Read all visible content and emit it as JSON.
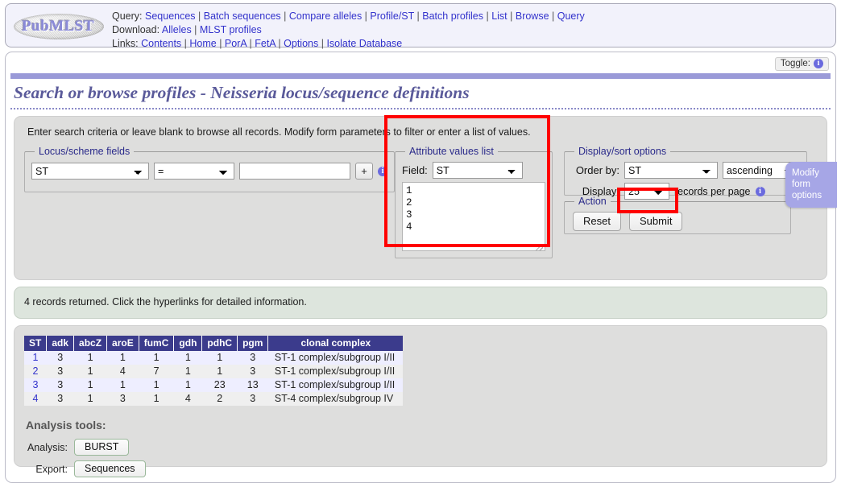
{
  "header": {
    "logo_text": "PubMLST",
    "nav": [
      {
        "label": "Query:",
        "links": [
          "Sequences",
          "Batch sequences",
          "Compare alleles",
          "Profile/ST",
          "Batch profiles",
          "List",
          "Browse",
          "Query"
        ]
      },
      {
        "label": "Download:",
        "links": [
          "Alleles",
          "MLST profiles"
        ]
      },
      {
        "label": "Links:",
        "links": [
          "Contents",
          "Home",
          "PorA",
          "FetA",
          "Options",
          "Isolate Database"
        ]
      }
    ]
  },
  "toggle": {
    "label": "Toggle:",
    "icon": "info-icon"
  },
  "page": {
    "title": "Search or browse profiles - Neisseria locus/sequence definitions",
    "intro": "Enter search criteria or leave blank to browse all records. Modify form parameters to filter or enter a list of values."
  },
  "modify_tab": {
    "line1": "Modify",
    "line2": "form",
    "line3": "options"
  },
  "form": {
    "locus_fieldset": {
      "legend": "Locus/scheme fields",
      "field_value": "ST",
      "operator_value": "=",
      "text_value": "",
      "text_placeholder": "",
      "add_button": "+",
      "info_icon": "info-icon"
    },
    "attribute_fieldset": {
      "legend": "Attribute values list",
      "field_label": "Field:",
      "field_value": "ST",
      "textarea_value": "1\n2\n3\n4"
    },
    "display_fieldset": {
      "legend": "Display/sort options",
      "order_label": "Order by:",
      "order_value": "ST",
      "direction_value": "ascending",
      "display_label": "Display:",
      "display_value": "25",
      "display_tail": "records per page",
      "info_icon": "info-icon"
    },
    "action_fieldset": {
      "legend": "Action",
      "reset_label": "Reset",
      "submit_label": "Submit"
    }
  },
  "result_message": "4 records returned. Click the hyperlinks for detailed information.",
  "results_table": {
    "columns": [
      "ST",
      "adk",
      "abcZ",
      "aroE",
      "fumC",
      "gdh",
      "pdhC",
      "pgm",
      "clonal complex"
    ],
    "rows": [
      {
        "st": "1",
        "adk": "3",
        "abcZ": "1",
        "aroE": "1",
        "fumC": "1",
        "gdh": "1",
        "pdhC": "1",
        "pgm": "3",
        "clonal_complex": "ST-1 complex/subgroup I/II"
      },
      {
        "st": "2",
        "adk": "3",
        "abcZ": "1",
        "aroE": "4",
        "fumC": "7",
        "gdh": "1",
        "pdhC": "1",
        "pgm": "3",
        "clonal_complex": "ST-1 complex/subgroup I/II"
      },
      {
        "st": "3",
        "adk": "3",
        "abcZ": "1",
        "aroE": "1",
        "fumC": "1",
        "gdh": "1",
        "pdhC": "23",
        "pgm": "13",
        "clonal_complex": "ST-1 complex/subgroup I/II"
      },
      {
        "st": "4",
        "adk": "3",
        "abcZ": "1",
        "aroE": "3",
        "fumC": "1",
        "gdh": "4",
        "pdhC": "2",
        "pgm": "3",
        "clonal_complex": "ST-4 complex/subgroup IV"
      }
    ]
  },
  "analysis": {
    "heading": "Analysis tools:",
    "analysis_label": "Analysis:",
    "analysis_button": "BURST",
    "export_label": "Export:",
    "export_button": "Sequences"
  },
  "colors": {
    "link": "#3333cc",
    "title": "#5a5a9a",
    "table_header": "#3b3b8c",
    "row_odd": "#eeeeff",
    "row_even": "#efefef",
    "annotation": "#ff0000",
    "modify_tab": "#a6a6e6",
    "message_bg": "#dde5dd"
  }
}
